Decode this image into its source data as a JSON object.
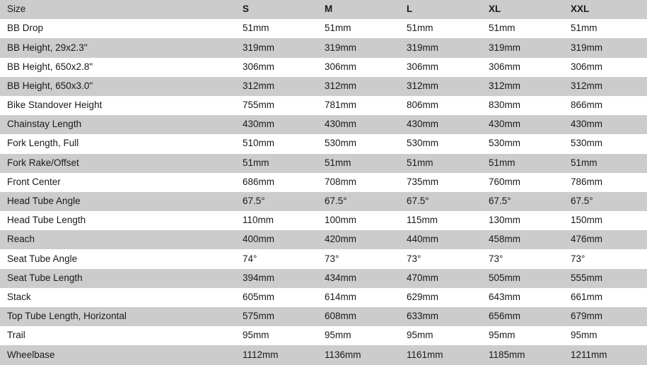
{
  "table": {
    "label_header": "Size",
    "columns": [
      "S",
      "M",
      "L",
      "XL",
      "XXL"
    ],
    "rows": [
      {
        "label": "BB Drop",
        "values": [
          "51mm",
          "51mm",
          "51mm",
          "51mm",
          "51mm"
        ]
      },
      {
        "label": "BB Height, 29x2.3\"",
        "values": [
          "319mm",
          "319mm",
          "319mm",
          "319mm",
          "319mm"
        ]
      },
      {
        "label": "BB Height, 650x2.8\"",
        "values": [
          "306mm",
          "306mm",
          "306mm",
          "306mm",
          "306mm"
        ]
      },
      {
        "label": "BB Height, 650x3.0\"",
        "values": [
          "312mm",
          "312mm",
          "312mm",
          "312mm",
          "312mm"
        ]
      },
      {
        "label": "Bike Standover Height",
        "values": [
          "755mm",
          "781mm",
          "806mm",
          "830mm",
          "866mm"
        ]
      },
      {
        "label": "Chainstay Length",
        "values": [
          "430mm",
          "430mm",
          "430mm",
          "430mm",
          "430mm"
        ]
      },
      {
        "label": "Fork Length, Full",
        "values": [
          "510mm",
          "530mm",
          "530mm",
          "530mm",
          "530mm"
        ]
      },
      {
        "label": "Fork Rake/Offset",
        "values": [
          "51mm",
          "51mm",
          "51mm",
          "51mm",
          "51mm"
        ]
      },
      {
        "label": "Front Center",
        "values": [
          "686mm",
          "708mm",
          "735mm",
          "760mm",
          "786mm"
        ]
      },
      {
        "label": "Head Tube Angle",
        "values": [
          "67.5°",
          "67.5°",
          "67.5°",
          "67.5°",
          "67.5°"
        ]
      },
      {
        "label": "Head Tube Length",
        "values": [
          "110mm",
          "100mm",
          "115mm",
          "130mm",
          "150mm"
        ]
      },
      {
        "label": "Reach",
        "values": [
          "400mm",
          "420mm",
          "440mm",
          "458mm",
          "476mm"
        ]
      },
      {
        "label": "Seat Tube Angle",
        "values": [
          "74°",
          "73°",
          "73°",
          "73°",
          "73°"
        ]
      },
      {
        "label": "Seat Tube Length",
        "values": [
          "394mm",
          "434mm",
          "470mm",
          "505mm",
          "555mm"
        ]
      },
      {
        "label": "Stack",
        "values": [
          "605mm",
          "614mm",
          "629mm",
          "643mm",
          "661mm"
        ]
      },
      {
        "label": "Top Tube Length, Horizontal",
        "values": [
          "575mm",
          "608mm",
          "633mm",
          "656mm",
          "679mm"
        ]
      },
      {
        "label": "Trail",
        "values": [
          "95mm",
          "95mm",
          "95mm",
          "95mm",
          "95mm"
        ]
      },
      {
        "label": "Wheelbase",
        "values": [
          "1112mm",
          "1136mm",
          "1161mm",
          "1185mm",
          "1211mm"
        ]
      }
    ]
  },
  "style": {
    "stripe_color": "#cccccc",
    "base_color": "#ffffff",
    "text_color": "#1a1a1a"
  }
}
